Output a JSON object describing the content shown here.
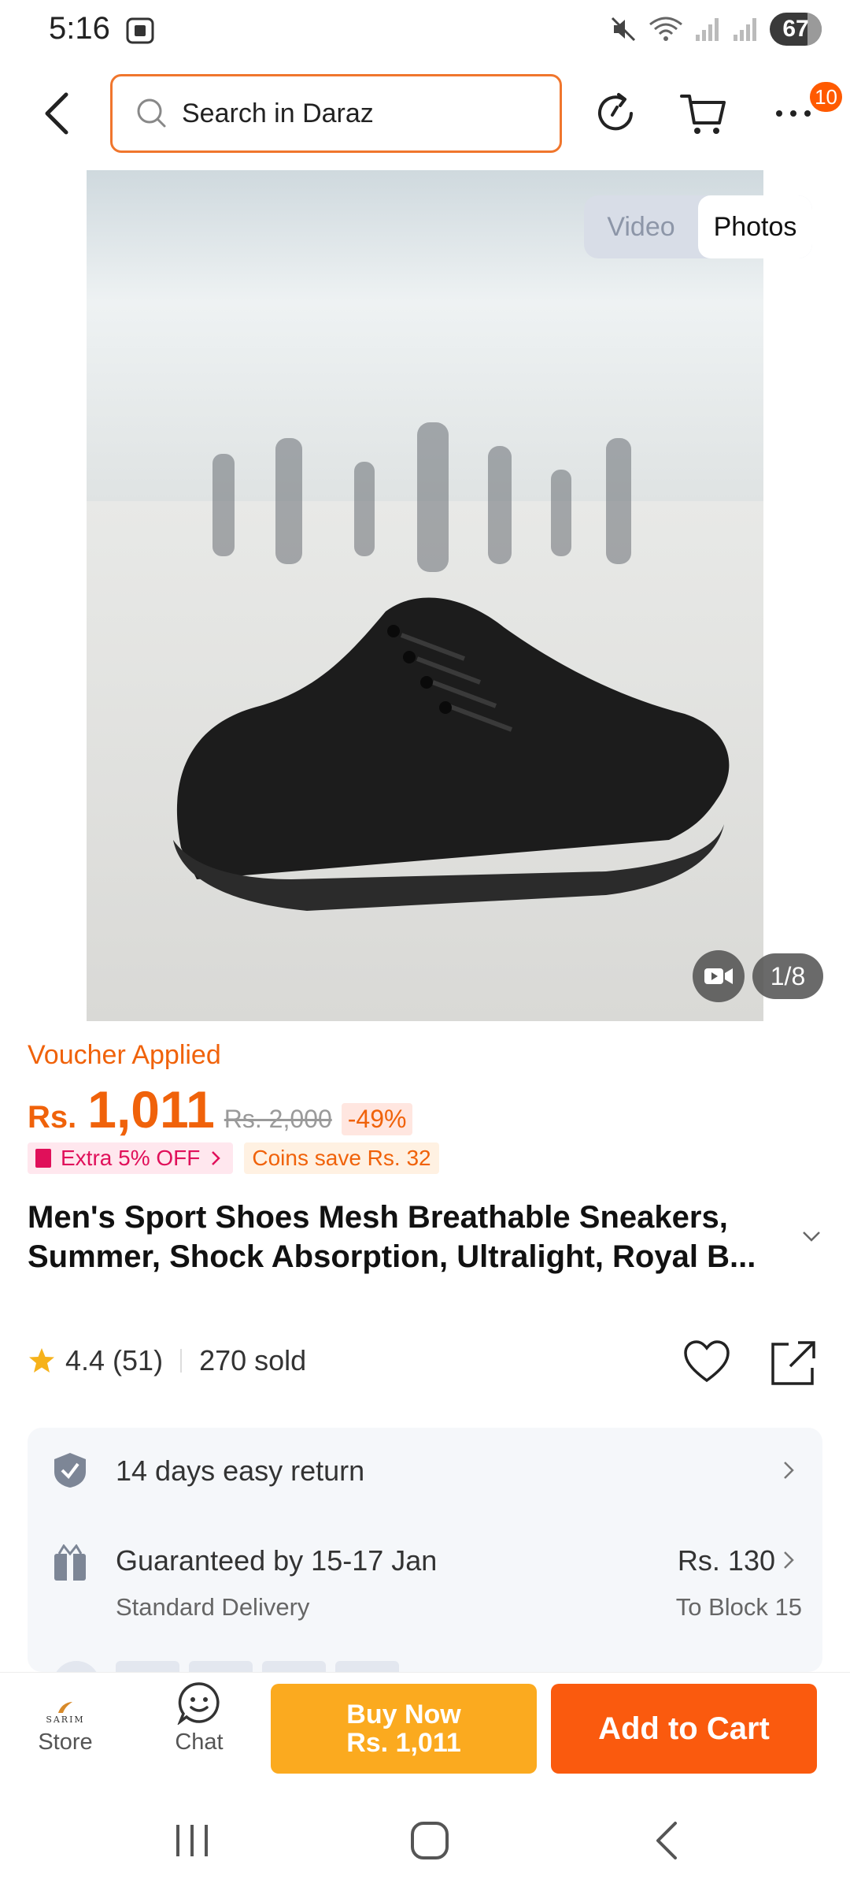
{
  "status_bar": {
    "time": "5:16",
    "battery": "67",
    "icons": [
      "screenshot-icon",
      "mute-icon",
      "wifi-icon",
      "signal-icon",
      "signal-icon"
    ]
  },
  "header": {
    "search_placeholder": "Search in Daraz",
    "cart_badge": "10",
    "icons": [
      "back-icon",
      "search-icon",
      "history-icon",
      "cart-icon",
      "more-icon"
    ]
  },
  "gallery": {
    "toggle_video": "Video",
    "toggle_photos": "Photos",
    "counter": "1/8"
  },
  "product": {
    "voucher": "Voucher Applied",
    "currency": "Rs.",
    "price": "1,011",
    "old_price": "Rs. 2,000",
    "discount": "-49%",
    "promo_extra": "Extra 5% OFF",
    "promo_coins": "Coins save Rs. 32",
    "title": "Men's Sport Shoes Mesh Breathable Sneakers, Summer, Shock Absorption, Ultralight, Royal B...",
    "rating": "4.4",
    "reviews": "(51)",
    "sold": "270 sold"
  },
  "services": {
    "return_text": "14 days easy return",
    "delivery_text": "Guaranteed by 15-17 Jan",
    "delivery_sub": "Standard Delivery",
    "delivery_fee": "Rs. 130",
    "delivery_to": "To Block 15"
  },
  "bottom_bar": {
    "store_label": "Store",
    "store_logo_text": "SARIM",
    "chat_label": "Chat",
    "buy_now_label": "Buy Now",
    "buy_now_price": "Rs. 1,011",
    "add_to_cart_label": "Add to Cart"
  },
  "colors": {
    "accent": "#f0620a",
    "buy_now": "#fbaa1f",
    "add_to_cart": "#fa5a0e",
    "search_border": "#f0762d"
  }
}
